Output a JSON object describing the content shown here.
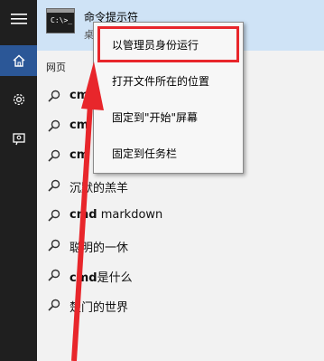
{
  "rail": {
    "items": [
      {
        "name": "hamburger-menu-icon",
        "active": false
      },
      {
        "name": "home-icon",
        "active": true
      },
      {
        "name": "settings-gear-icon",
        "active": false
      },
      {
        "name": "feedback-person-icon",
        "active": false
      }
    ]
  },
  "best_match": {
    "title": "命令提示符",
    "subtitle": "桌"
  },
  "section_label": "网页",
  "results": [
    {
      "bold": "cmd",
      "rest": ""
    },
    {
      "bold": "cm",
      "rest": ""
    },
    {
      "bold": "cm",
      "rest": ""
    },
    {
      "bold": "",
      "rest": "沉默的羔羊"
    },
    {
      "bold": "cmd",
      "rest": " markdown"
    },
    {
      "bold": "",
      "rest": "聪明的一休"
    },
    {
      "bold": "cmd",
      "rest": "是什么"
    },
    {
      "bold": "",
      "rest": "楚门的世界"
    }
  ],
  "context_menu": {
    "items": [
      "以管理员身份运行",
      "打开文件所在的位置",
      "固定到\"开始\"屏幕",
      "固定到任务栏"
    ],
    "highlighted_index": 0
  },
  "annotation": {
    "color": "#e8262b"
  },
  "colors": {
    "rail": "#1f1f1f",
    "rail_active": "#2b5797",
    "best_match_bg": "#cfe3f6",
    "panel_bg": "#f2f2f2"
  }
}
